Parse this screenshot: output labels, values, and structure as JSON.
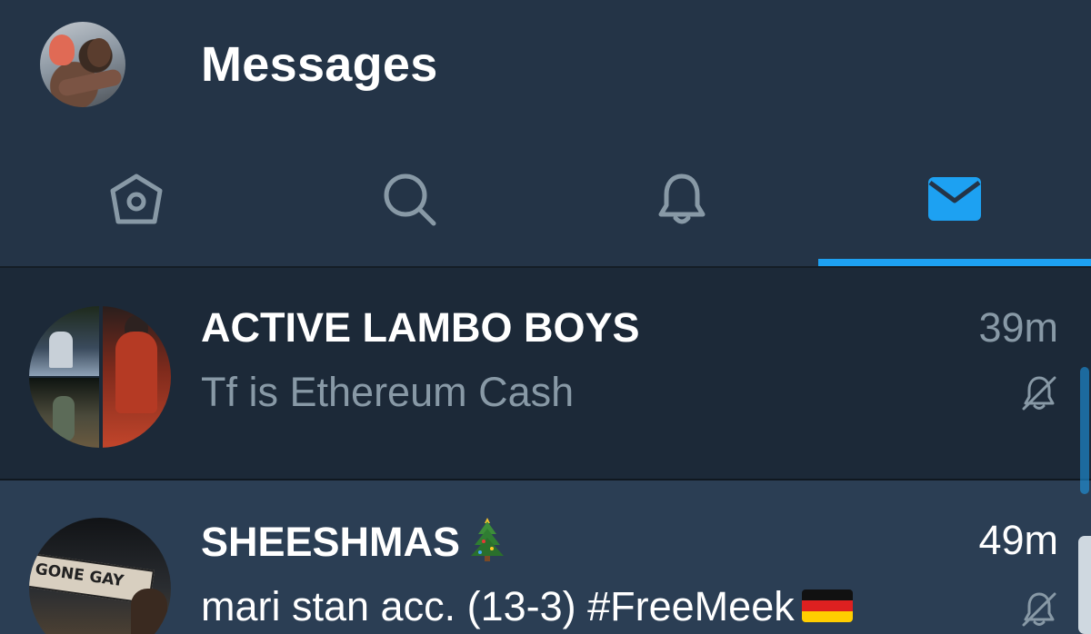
{
  "header": {
    "title": "Messages"
  },
  "tabs": [
    {
      "name": "home",
      "icon": "home-icon",
      "active": false
    },
    {
      "name": "search",
      "icon": "search-icon",
      "active": false
    },
    {
      "name": "notifications",
      "icon": "bell-icon",
      "active": false
    },
    {
      "name": "messages",
      "icon": "envelope-icon",
      "active": true
    }
  ],
  "conversations": [
    {
      "name": "ACTIVE LAMBO BOYS",
      "preview": "Tf is Ethereum Cash",
      "time": "39m",
      "muted": true,
      "avatar": "group-avatar"
    },
    {
      "name": "SHEESHMAS",
      "name_emoji": "christmas-tree-emoji",
      "preview": "mari stan acc. (13-3) #FreeMeek",
      "preview_emoji": "germany-flag-emoji",
      "time": "49m",
      "muted": true,
      "avatar_sign_text": "GONE GAY"
    }
  ],
  "colors": {
    "background": "#243447",
    "accent": "#1da1f2",
    "muted_text": "#8899a6",
    "row_selected": "#1c2938",
    "row_default": "#2b3e54"
  }
}
